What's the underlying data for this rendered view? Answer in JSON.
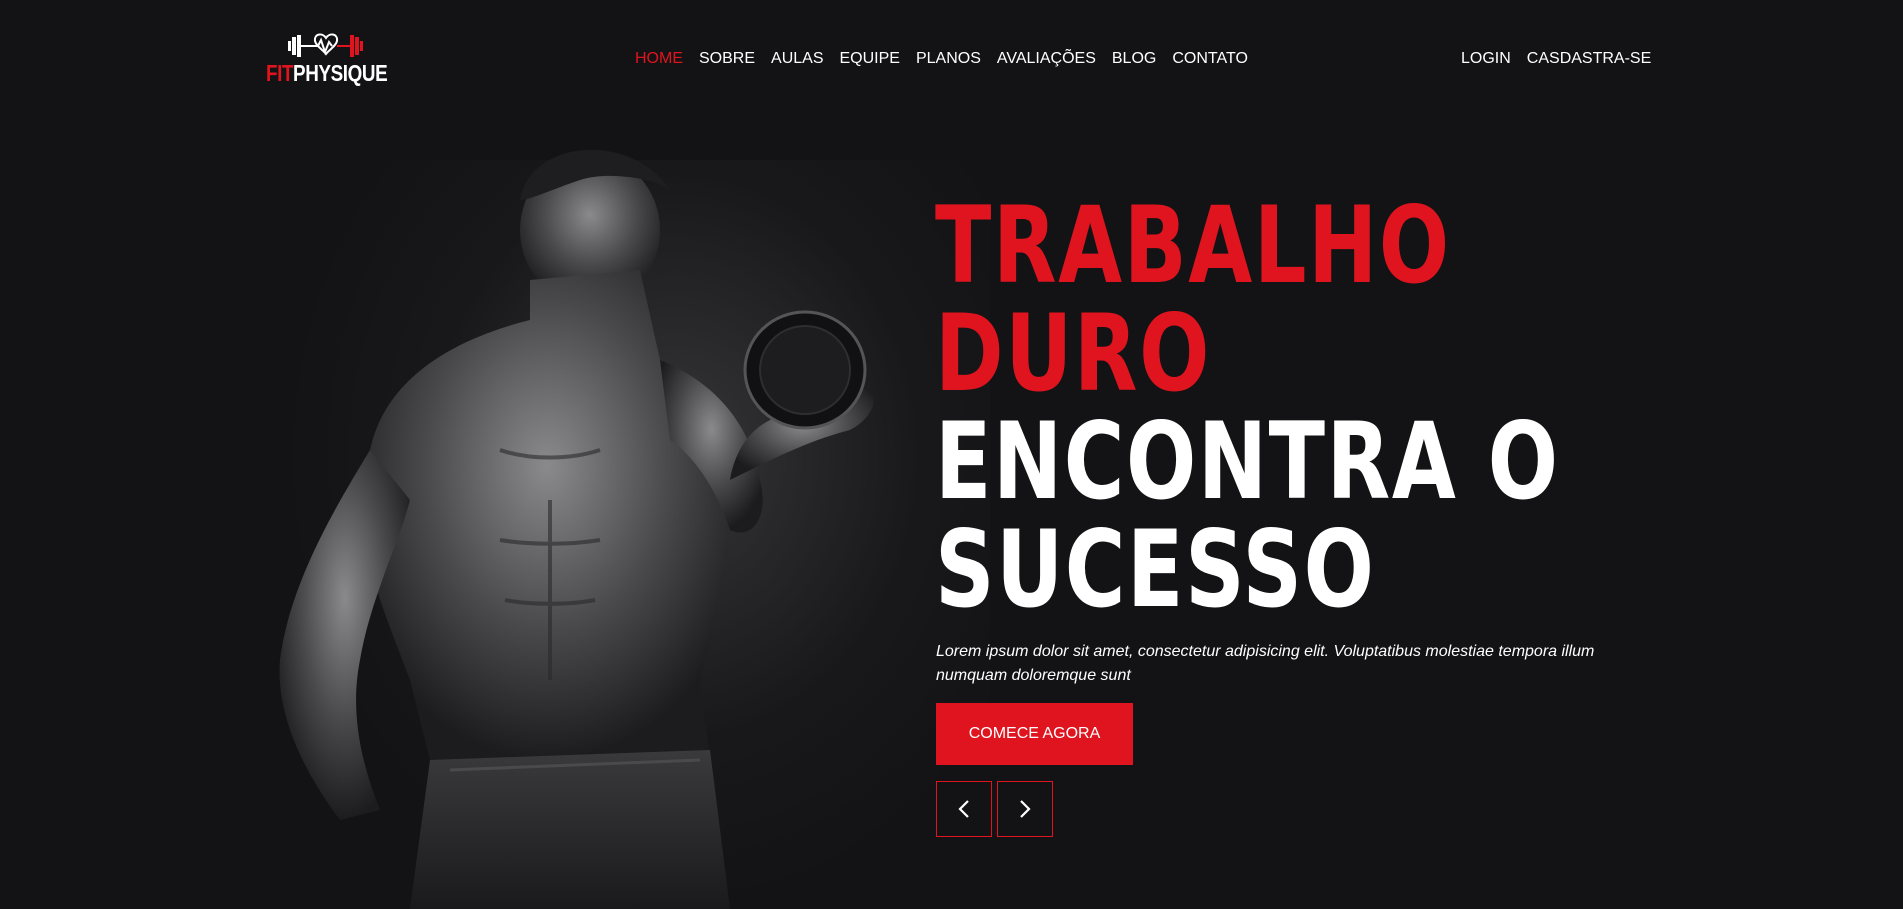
{
  "brand": {
    "fit": "FIT",
    "physique": "PHYSIQUE"
  },
  "nav": {
    "items": [
      {
        "label": "HOME",
        "active": true
      },
      {
        "label": "SOBRE"
      },
      {
        "label": "AULAS"
      },
      {
        "label": "EQUIPE"
      },
      {
        "label": "PLANOS"
      },
      {
        "label": "AVALIAÇÕES"
      },
      {
        "label": "BLOG"
      },
      {
        "label": "CONTATO"
      }
    ]
  },
  "auth": {
    "login": "LOGIN",
    "register": "CASDASTRA-SE"
  },
  "hero": {
    "line1": "TRABALHO",
    "line2": "DURO",
    "line3": "ENCONTRA O",
    "line4": "SUCESSO",
    "lead": "Lorem ipsum dolor sit amet, consectetur adipisicing elit. Voluptatibus molestiae tempora illum numquam doloremque sunt",
    "cta": "COMECE AGORA",
    "prev_icon": "chevron-left-icon",
    "next_icon": "chevron-right-icon"
  },
  "colors": {
    "accent": "#e0141e",
    "background": "#131315"
  }
}
